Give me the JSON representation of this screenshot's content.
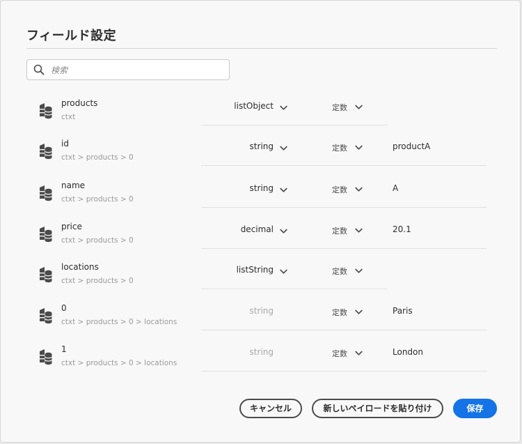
{
  "dialog": {
    "title": "フィールド設定",
    "search": {
      "placeholder": "検索",
      "value": ""
    }
  },
  "fields": [
    {
      "name": "products",
      "path": "ctxt",
      "type": "listObject",
      "type_enabled": true,
      "mode": "定数",
      "mode_dropdown": true,
      "value": ""
    },
    {
      "name": "id",
      "path": "ctxt > products > 0",
      "type": "string",
      "type_enabled": true,
      "mode": "定数",
      "mode_dropdown": true,
      "value": "productA"
    },
    {
      "name": "name",
      "path": "ctxt > products > 0",
      "type": "string",
      "type_enabled": true,
      "mode": "定数",
      "mode_dropdown": true,
      "value": "A"
    },
    {
      "name": "price",
      "path": "ctxt > products > 0",
      "type": "decimal",
      "type_enabled": true,
      "mode": "定数",
      "mode_dropdown": true,
      "value": "20.1"
    },
    {
      "name": "locations",
      "path": "ctxt > products > 0",
      "type": "listString",
      "type_enabled": true,
      "mode": "定数",
      "mode_dropdown": true,
      "value": ""
    },
    {
      "name": "0",
      "path": "ctxt > products > 0 > locations",
      "type": "string",
      "type_enabled": false,
      "mode": "定数",
      "mode_dropdown": true,
      "value": "Paris"
    },
    {
      "name": "1",
      "path": "ctxt > products > 0 > locations",
      "type": "string",
      "type_enabled": false,
      "mode": "定数",
      "mode_dropdown": true,
      "value": "London"
    }
  ],
  "buttons": {
    "cancel": "キャンセル",
    "paste_payload": "新しいペイロードを貼り付け",
    "save": "保存"
  },
  "icons": {
    "search": "search-icon",
    "field": "field-data-icon",
    "chevron": "chevron-down-icon"
  },
  "colors": {
    "primary": "#1473e6",
    "text": "#2c2c2c",
    "muted": "#9a9a9a"
  }
}
